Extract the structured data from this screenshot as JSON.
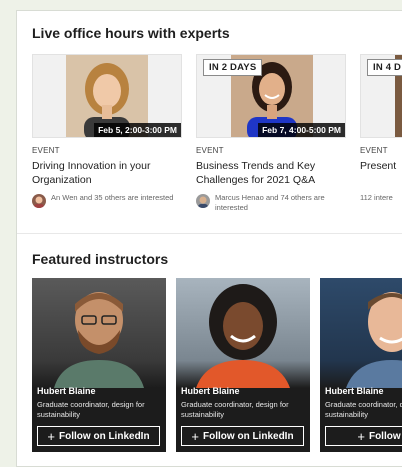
{
  "office_hours": {
    "title": "Live office hours with experts",
    "events": [
      {
        "badge": "",
        "date": "Feb 5, 2:00-3:00 PM",
        "kind": "EVENT",
        "title": "Driving Innovation in your Organization",
        "interest": "An Wen and 35 others are interested"
      },
      {
        "badge": "IN 2 DAYS",
        "date": "Feb 7, 4:00-5:00 PM",
        "kind": "EVENT",
        "title": "Business Trends and Key Challenges for 2021 Q&A",
        "interest": "Marcus Henao and 74 others are interested"
      },
      {
        "badge": "IN 4 D",
        "date": "",
        "kind": "EVENT",
        "title": "Present",
        "interest": "112 intere"
      }
    ]
  },
  "featured": {
    "title": "Featured instructors",
    "instructors": [
      {
        "name": "Hubert Blaine",
        "role": "Graduate coordinator, design for sustainability",
        "follow_label": "Follow on LinkedIn"
      },
      {
        "name": "Hubert Blaine",
        "role": "Graduate coordinator, design for sustainability",
        "follow_label": "Follow on LinkedIn"
      },
      {
        "name": "Hubert Blaine",
        "role": "Graduate coordinator, design for sustainability",
        "follow_label": "Follow on"
      }
    ]
  },
  "icons": {
    "follow": "plus-icon"
  }
}
